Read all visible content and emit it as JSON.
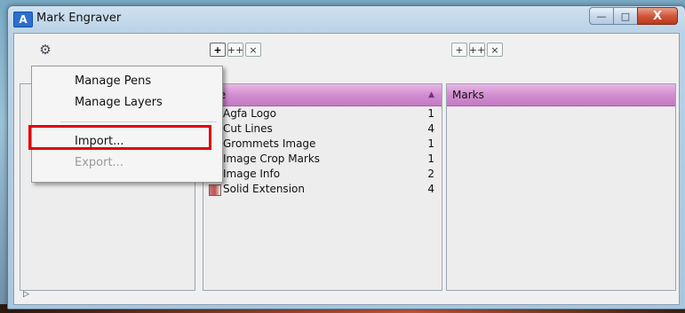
{
  "window": {
    "app_icon_text": "A",
    "title": "Mark Engraver",
    "buttons": {
      "minimize": "—",
      "maximize": "□",
      "close": "X"
    }
  },
  "toolbar": {
    "gear_icon": "⚙",
    "mid_add": "+",
    "mid_add_multi": "++",
    "mid_delete": "×",
    "right_add": "+",
    "right_add_multi": "++",
    "right_delete": "×"
  },
  "menu": {
    "items": [
      {
        "label": "Manage Pens",
        "enabled": true
      },
      {
        "label": "Manage Layers",
        "enabled": true
      },
      {
        "label": "Import...",
        "enabled": true,
        "highlighted": true
      },
      {
        "label": "Export...",
        "enabled": false
      }
    ]
  },
  "mid_panel": {
    "header": "me",
    "sort_indicator": "▲",
    "rows": [
      {
        "name": "Agfa Logo",
        "count": "1"
      },
      {
        "name": "Cut Lines",
        "count": "4"
      },
      {
        "name": "Grommets Image",
        "count": "1"
      },
      {
        "name": "Image Crop Marks",
        "count": "1"
      },
      {
        "name": "Image Info",
        "count": "2"
      },
      {
        "name": "Solid Extension",
        "count": "4"
      }
    ]
  },
  "right_panel": {
    "header": "Marks"
  },
  "footer": {
    "expander": "▷"
  },
  "colors": {
    "header_accent": "#d18ed0",
    "highlight": "#e00000"
  }
}
